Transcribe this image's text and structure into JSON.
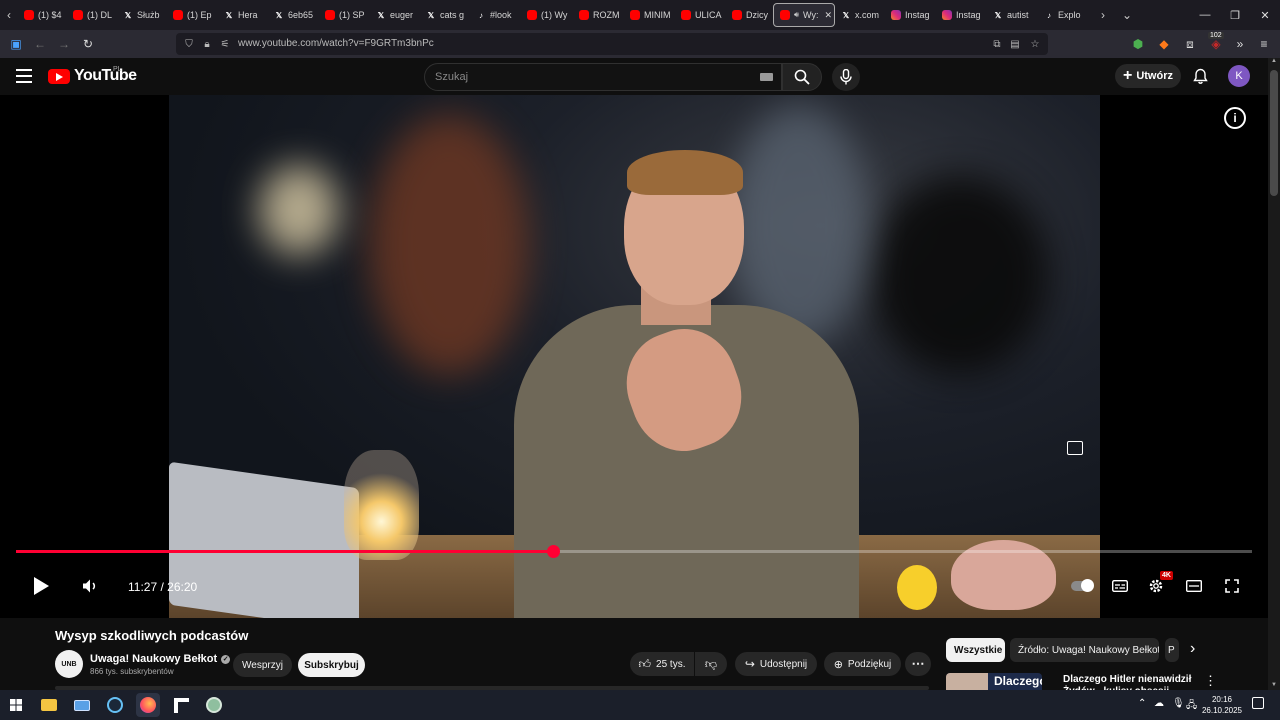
{
  "browser": {
    "tabs": [
      {
        "icon": "youtube-icon",
        "label": "(1) $4"
      },
      {
        "icon": "youtube-icon",
        "label": "(1) DL"
      },
      {
        "icon": "x-icon",
        "label": "Służb"
      },
      {
        "icon": "youtube-icon",
        "label": "(1) Ep"
      },
      {
        "icon": "x-icon",
        "label": "Hera"
      },
      {
        "icon": "x-icon",
        "label": "6eb65"
      },
      {
        "icon": "youtube-icon",
        "label": "(1) SP"
      },
      {
        "icon": "x-icon",
        "label": "euger"
      },
      {
        "icon": "x-icon",
        "label": "cats g"
      },
      {
        "icon": "tiktok-icon",
        "label": "#look"
      },
      {
        "icon": "youtube-icon",
        "label": "(1) Wy"
      },
      {
        "icon": "youtube-icon",
        "label": "ROZM"
      },
      {
        "icon": "youtube-icon",
        "label": "MINIM"
      },
      {
        "icon": "youtube-icon",
        "label": "ULICA"
      },
      {
        "icon": "youtube-icon",
        "label": "Dzicy"
      },
      {
        "icon": "youtube-icon",
        "label": "Wy:"
      },
      {
        "icon": "x-icon",
        "label": "x.com"
      },
      {
        "icon": "instagram-icon",
        "label": "Instag"
      },
      {
        "icon": "instagram-icon",
        "label": "Instag"
      },
      {
        "icon": "x-icon",
        "label": "autist"
      },
      {
        "icon": "tiktok-icon",
        "label": "Explo"
      }
    ],
    "url": "www.youtube.com/watch?v=F9GRTm3bnPc",
    "extensions_badge": "102"
  },
  "youtube": {
    "logo_text": "YouTube",
    "country": "PL",
    "search_placeholder": "Szukaj",
    "create_label": "Utwórz",
    "avatar_letter": "K"
  },
  "player": {
    "current_time": "11:27",
    "duration": "26:20",
    "time_display": "11:27 / 26:20",
    "progress_fraction": 0.4348,
    "quality_badge": "4K",
    "accent_color": "#ff0033"
  },
  "video": {
    "title": "Wysyp szkodliwych podcastów",
    "channel_name": "Uwaga! Naukowy Bełkot",
    "channel_avatar_text": "UNB",
    "subscribers": "866 tys. subskrybentów",
    "support_label": "Wesprzyj",
    "subscribe_label": "Subskrybuj",
    "likes": "25 tys.",
    "share_label": "Udostępnij",
    "thanks_label": "Podziękuj"
  },
  "sidebar": {
    "chips": [
      {
        "label": "Wszystkie",
        "active": true
      },
      {
        "label": "Źródło: Uwaga! Naukowy Bełkot",
        "active": false
      },
      {
        "label": "P",
        "active": false
      }
    ],
    "recommended": {
      "thumb_text": "Dlaczego Hitler",
      "title": "Dlaczego Hitler nienawidził Żydów - kulisy obsesji"
    }
  },
  "taskbar": {
    "time": "20:16",
    "date": "26.10.2025"
  }
}
